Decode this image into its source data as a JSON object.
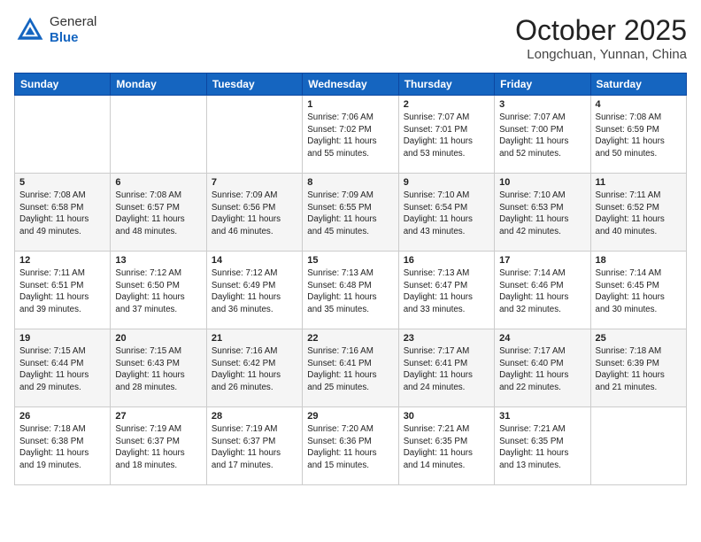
{
  "header": {
    "logo_line1": "General",
    "logo_line2": "Blue",
    "month_title": "October 2025",
    "location": "Longchuan, Yunnan, China"
  },
  "days_of_week": [
    "Sunday",
    "Monday",
    "Tuesday",
    "Wednesday",
    "Thursday",
    "Friday",
    "Saturday"
  ],
  "weeks": [
    [
      {
        "day": "",
        "info": ""
      },
      {
        "day": "",
        "info": ""
      },
      {
        "day": "",
        "info": ""
      },
      {
        "day": "1",
        "info": "Sunrise: 7:06 AM\nSunset: 7:02 PM\nDaylight: 11 hours\nand 55 minutes."
      },
      {
        "day": "2",
        "info": "Sunrise: 7:07 AM\nSunset: 7:01 PM\nDaylight: 11 hours\nand 53 minutes."
      },
      {
        "day": "3",
        "info": "Sunrise: 7:07 AM\nSunset: 7:00 PM\nDaylight: 11 hours\nand 52 minutes."
      },
      {
        "day": "4",
        "info": "Sunrise: 7:08 AM\nSunset: 6:59 PM\nDaylight: 11 hours\nand 50 minutes."
      }
    ],
    [
      {
        "day": "5",
        "info": "Sunrise: 7:08 AM\nSunset: 6:58 PM\nDaylight: 11 hours\nand 49 minutes."
      },
      {
        "day": "6",
        "info": "Sunrise: 7:08 AM\nSunset: 6:57 PM\nDaylight: 11 hours\nand 48 minutes."
      },
      {
        "day": "7",
        "info": "Sunrise: 7:09 AM\nSunset: 6:56 PM\nDaylight: 11 hours\nand 46 minutes."
      },
      {
        "day": "8",
        "info": "Sunrise: 7:09 AM\nSunset: 6:55 PM\nDaylight: 11 hours\nand 45 minutes."
      },
      {
        "day": "9",
        "info": "Sunrise: 7:10 AM\nSunset: 6:54 PM\nDaylight: 11 hours\nand 43 minutes."
      },
      {
        "day": "10",
        "info": "Sunrise: 7:10 AM\nSunset: 6:53 PM\nDaylight: 11 hours\nand 42 minutes."
      },
      {
        "day": "11",
        "info": "Sunrise: 7:11 AM\nSunset: 6:52 PM\nDaylight: 11 hours\nand 40 minutes."
      }
    ],
    [
      {
        "day": "12",
        "info": "Sunrise: 7:11 AM\nSunset: 6:51 PM\nDaylight: 11 hours\nand 39 minutes."
      },
      {
        "day": "13",
        "info": "Sunrise: 7:12 AM\nSunset: 6:50 PM\nDaylight: 11 hours\nand 37 minutes."
      },
      {
        "day": "14",
        "info": "Sunrise: 7:12 AM\nSunset: 6:49 PM\nDaylight: 11 hours\nand 36 minutes."
      },
      {
        "day": "15",
        "info": "Sunrise: 7:13 AM\nSunset: 6:48 PM\nDaylight: 11 hours\nand 35 minutes."
      },
      {
        "day": "16",
        "info": "Sunrise: 7:13 AM\nSunset: 6:47 PM\nDaylight: 11 hours\nand 33 minutes."
      },
      {
        "day": "17",
        "info": "Sunrise: 7:14 AM\nSunset: 6:46 PM\nDaylight: 11 hours\nand 32 minutes."
      },
      {
        "day": "18",
        "info": "Sunrise: 7:14 AM\nSunset: 6:45 PM\nDaylight: 11 hours\nand 30 minutes."
      }
    ],
    [
      {
        "day": "19",
        "info": "Sunrise: 7:15 AM\nSunset: 6:44 PM\nDaylight: 11 hours\nand 29 minutes."
      },
      {
        "day": "20",
        "info": "Sunrise: 7:15 AM\nSunset: 6:43 PM\nDaylight: 11 hours\nand 28 minutes."
      },
      {
        "day": "21",
        "info": "Sunrise: 7:16 AM\nSunset: 6:42 PM\nDaylight: 11 hours\nand 26 minutes."
      },
      {
        "day": "22",
        "info": "Sunrise: 7:16 AM\nSunset: 6:41 PM\nDaylight: 11 hours\nand 25 minutes."
      },
      {
        "day": "23",
        "info": "Sunrise: 7:17 AM\nSunset: 6:41 PM\nDaylight: 11 hours\nand 24 minutes."
      },
      {
        "day": "24",
        "info": "Sunrise: 7:17 AM\nSunset: 6:40 PM\nDaylight: 11 hours\nand 22 minutes."
      },
      {
        "day": "25",
        "info": "Sunrise: 7:18 AM\nSunset: 6:39 PM\nDaylight: 11 hours\nand 21 minutes."
      }
    ],
    [
      {
        "day": "26",
        "info": "Sunrise: 7:18 AM\nSunset: 6:38 PM\nDaylight: 11 hours\nand 19 minutes."
      },
      {
        "day": "27",
        "info": "Sunrise: 7:19 AM\nSunset: 6:37 PM\nDaylight: 11 hours\nand 18 minutes."
      },
      {
        "day": "28",
        "info": "Sunrise: 7:19 AM\nSunset: 6:37 PM\nDaylight: 11 hours\nand 17 minutes."
      },
      {
        "day": "29",
        "info": "Sunrise: 7:20 AM\nSunset: 6:36 PM\nDaylight: 11 hours\nand 15 minutes."
      },
      {
        "day": "30",
        "info": "Sunrise: 7:21 AM\nSunset: 6:35 PM\nDaylight: 11 hours\nand 14 minutes."
      },
      {
        "day": "31",
        "info": "Sunrise: 7:21 AM\nSunset: 6:35 PM\nDaylight: 11 hours\nand 13 minutes."
      },
      {
        "day": "",
        "info": ""
      }
    ]
  ]
}
